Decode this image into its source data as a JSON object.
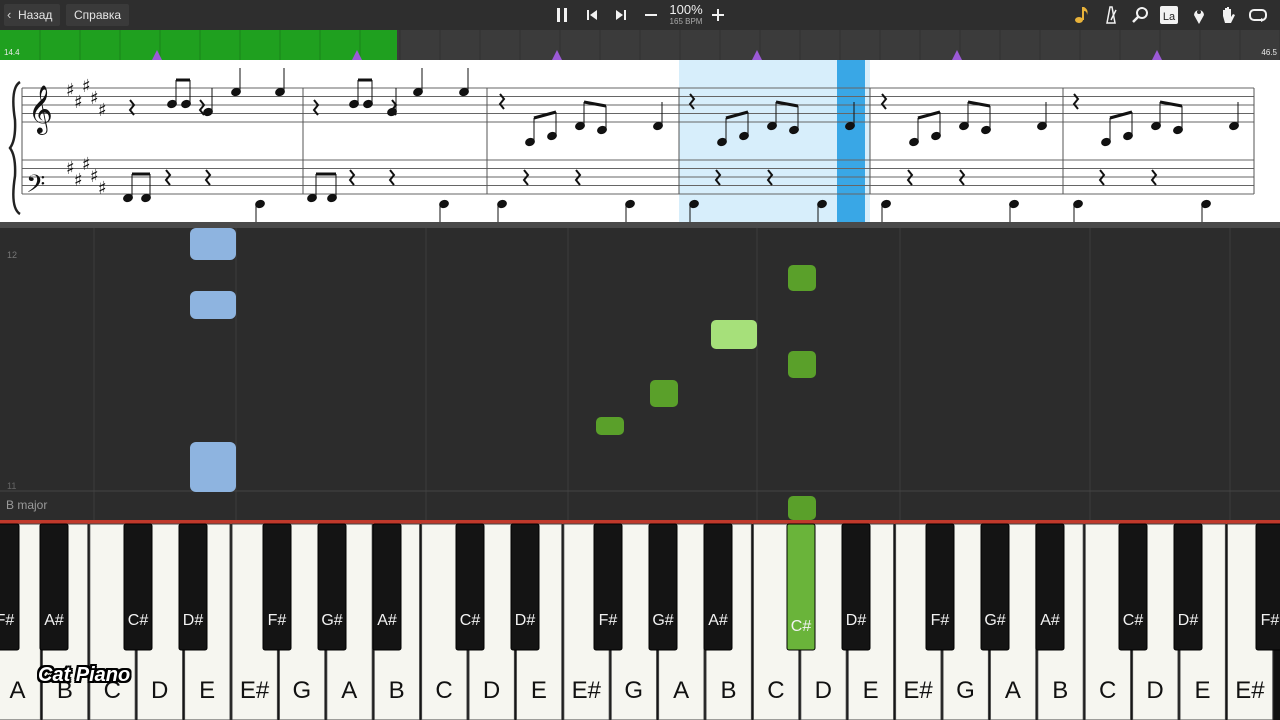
{
  "toolbar": {
    "back_label": "Назад",
    "help_label": "Справка",
    "speed_percent": "100%",
    "bpm_label": "165 BPM",
    "icons": {
      "back": "chevron-left-icon",
      "pause": "pause-icon",
      "prev": "skip-previous-icon",
      "next": "skip-next-icon",
      "minus": "minus-icon",
      "plus": "plus-icon",
      "note": "music-note-icon",
      "metronome": "metronome-icon",
      "search": "magnifier-icon",
      "la": "La",
      "marker": "location-pin-icon",
      "hand": "hand-icon",
      "loop": "loop-icon"
    },
    "note_icon_color": "#e8b23a"
  },
  "timeline": {
    "start_label": "14.4",
    "end_label": "46.5",
    "progress": 0.31,
    "fill_color": "#1fa01f",
    "marker_color": "#9b59d6"
  },
  "roll": {
    "measure_top": "12",
    "measure_bottom": "11",
    "key_signature": "B major",
    "left_hand_color": "#8eb4e0",
    "right_hand_color": "#5aa02a"
  },
  "keyboard": {
    "white_keys": [
      "A",
      "B",
      "C",
      "D",
      "E",
      "E#",
      "G",
      "A",
      "B",
      "C",
      "D",
      "E",
      "E#",
      "G",
      "A",
      "B",
      "C",
      "D",
      "E",
      "E#",
      "G",
      "A",
      "B",
      "C",
      "D",
      "E",
      "E#"
    ],
    "black_keys": [
      "F#",
      "A#",
      "C#",
      "D#",
      "F#",
      "G#",
      "A#",
      "C#",
      "D#",
      "F#",
      "G#",
      "A#",
      "C#",
      "D#",
      "F#",
      "G#",
      "A#",
      "C#",
      "D#",
      "F#"
    ],
    "pressed_black": "C#"
  },
  "watermark": "Cat Piano"
}
